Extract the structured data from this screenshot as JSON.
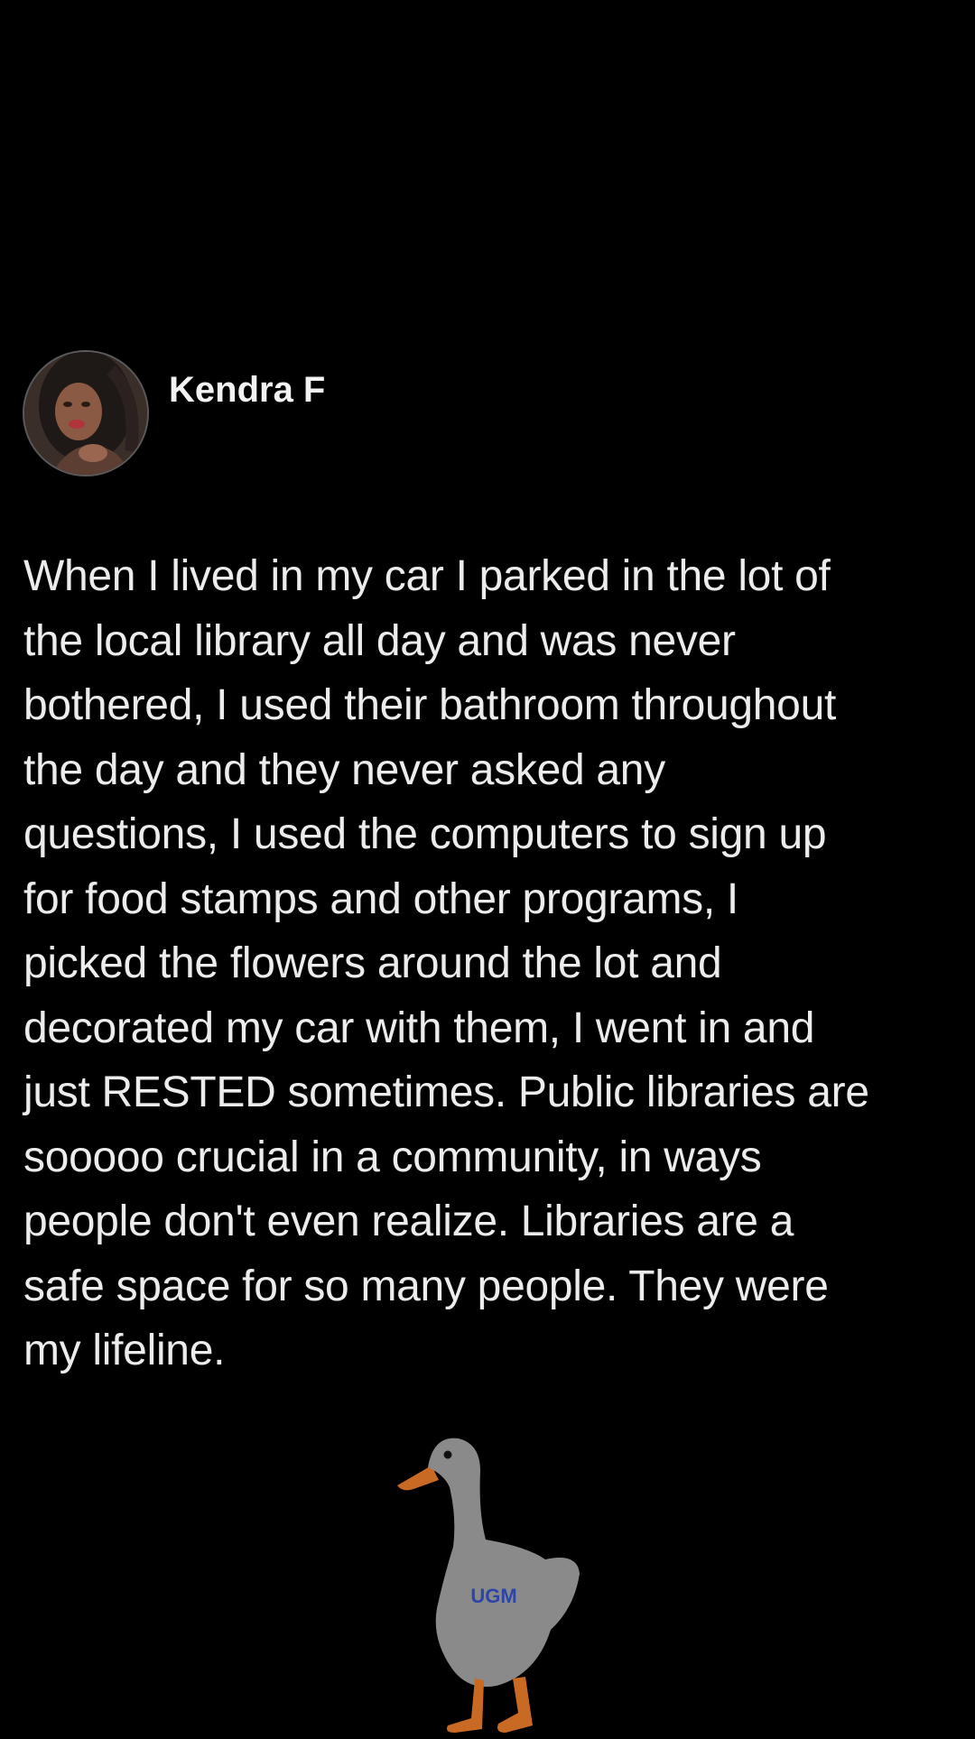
{
  "post": {
    "author_name": "Kendra F",
    "body_lines": [
      "When I lived in my car I parked in the lot of",
      "the local library all day and was never",
      "bothered, I used their bathroom throughout",
      "the day and they never asked any",
      "questions, I used the computers to sign up",
      "for food stamps and other programs, I",
      "picked the flowers around the lot and",
      "decorated my car with them, I went in and",
      "just RESTED sometimes. Public libraries are",
      "sooooo crucial in a community, in ways",
      "people don't even realize. Libraries are a",
      "safe space for so many people. They were",
      "my lifeline."
    ]
  },
  "watermark": {
    "icon": "goose-icon",
    "label": "UGM",
    "label_color": "#2e45a8"
  },
  "colors": {
    "background": "#000000",
    "text": "#ececec",
    "goose_body": "#8a8a8a",
    "goose_beak_legs": "#c96a24"
  }
}
